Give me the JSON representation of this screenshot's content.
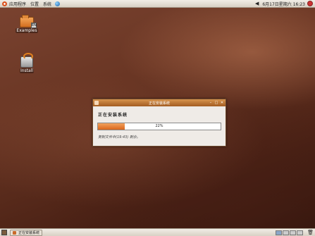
{
  "top_panel": {
    "menus": [
      "应用程序",
      "位置",
      "系统"
    ],
    "clock": "6月17日星期六 16:23"
  },
  "desktop": {
    "icons": [
      {
        "label": "Examples",
        "badge": "EN"
      },
      {
        "label": "Install"
      }
    ]
  },
  "dialog": {
    "title": "正在安装系统",
    "heading": "正在安装系统",
    "progress_value": 0.22,
    "progress_text": "22%",
    "status": "复制文件中(19:43) 剩余。"
  },
  "taskbar": {
    "task_label": "正在安装系统"
  },
  "colors": {
    "accent": "#d9661c",
    "panel": "#e6e0d5"
  }
}
